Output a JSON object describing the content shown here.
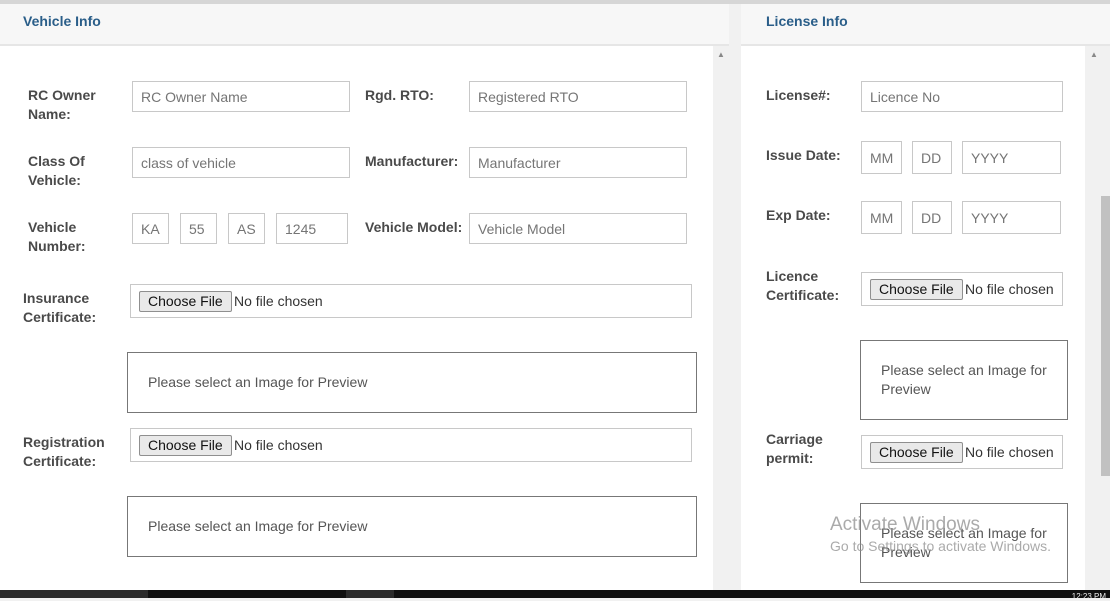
{
  "vehicle": {
    "title": "Vehicle Info",
    "rc_owner_label": "RC Owner Name:",
    "rc_owner_placeholder": "RC Owner Name",
    "rgd_rto_label": "Rgd. RTO:",
    "rgd_rto_placeholder": "Registered RTO",
    "class_label": "Class Of Vehicle:",
    "class_placeholder": "class of vehicle",
    "manufacturer_label": "Manufacturer:",
    "manufacturer_placeholder": "Manufacturer",
    "number_label": "Vehicle Number:",
    "number_parts": [
      "KA",
      "55",
      "AS",
      "1245"
    ],
    "model_label": "Vehicle Model:",
    "model_placeholder": "Vehicle Model",
    "insurance_label": "Insurance Certificate:",
    "registration_label": "Registration Certificate:"
  },
  "license": {
    "title": "License Info",
    "license_no_label": "License#:",
    "license_no_placeholder": "Licence No",
    "issue_label": "Issue Date:",
    "exp_label": "Exp Date:",
    "date_placeholders": {
      "mm": "MM",
      "dd": "DD",
      "yyyy": "YYYY"
    },
    "certificate_label": "Licence Certificate:",
    "carriage_label": "Carriage permit:"
  },
  "common": {
    "choose_file": "Choose File",
    "no_file": "No file chosen",
    "preview_text": "Please select an Image for Preview"
  },
  "watermark": {
    "title": "Activate Windows",
    "subtitle": "Go to Settings to activate Windows."
  },
  "taskbar": {
    "clock": "12:23 PM"
  },
  "colors": {
    "title": "#2a5e89",
    "label": "#4a4a4a",
    "border": "#c8c8c8"
  }
}
